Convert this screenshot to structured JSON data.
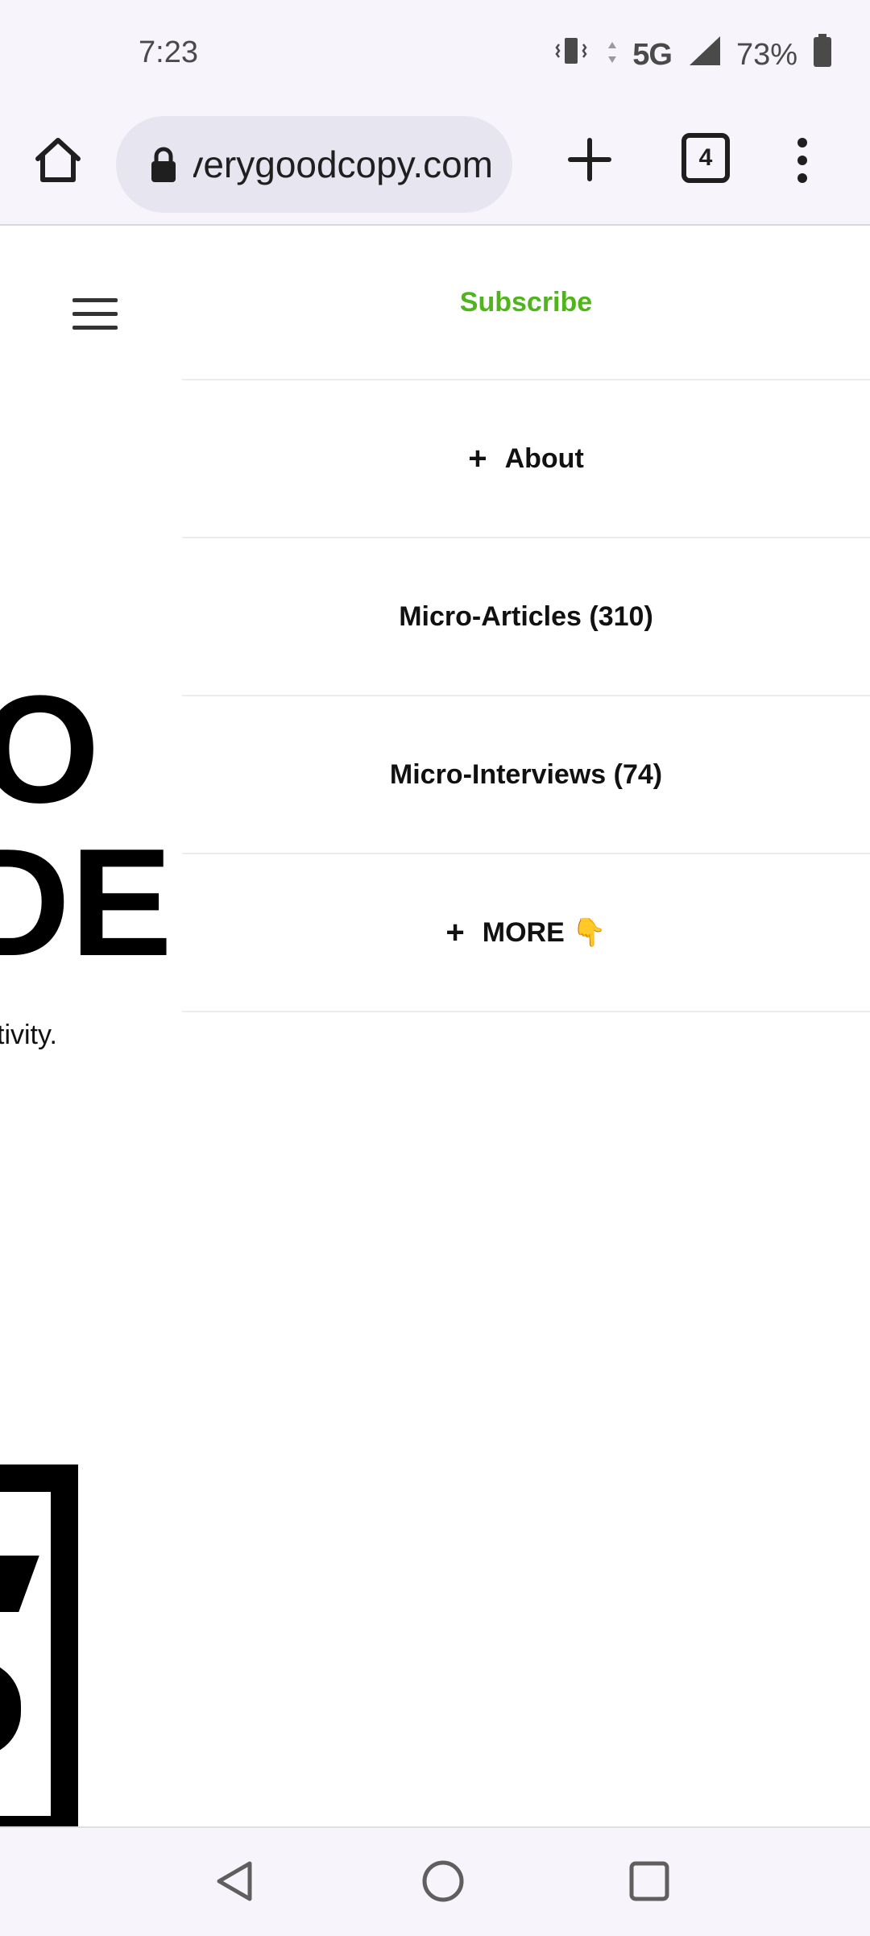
{
  "status_bar": {
    "time": "7:23",
    "network": "5G",
    "battery": "73%"
  },
  "browser": {
    "url": "verygoodcopy.com",
    "tab_count": "4"
  },
  "page": {
    "menu_items": [
      {
        "label": "Subscribe",
        "has_plus": false,
        "color": "#4fb51a"
      },
      {
        "label": "About",
        "has_plus": true
      },
      {
        "label": "Micro-Articles (310)",
        "has_plus": false
      },
      {
        "label": "Micro-Interviews (74)",
        "has_plus": false
      },
      {
        "label": "MORE 👇",
        "has_plus": true
      }
    ],
    "headline_line1": "O",
    "headline_line2": "DE",
    "tagline": "tivity."
  },
  "icons": {
    "home": "home-icon",
    "lock": "lock-icon",
    "new_tab": "plus-icon",
    "tabs": "tab-switcher-icon",
    "overflow_menu": "more-vert-icon",
    "hamburger": "hamburger-menu-icon",
    "back": "back-triangle-icon",
    "home_nav": "home-circle-icon",
    "recents": "recents-square-icon"
  }
}
